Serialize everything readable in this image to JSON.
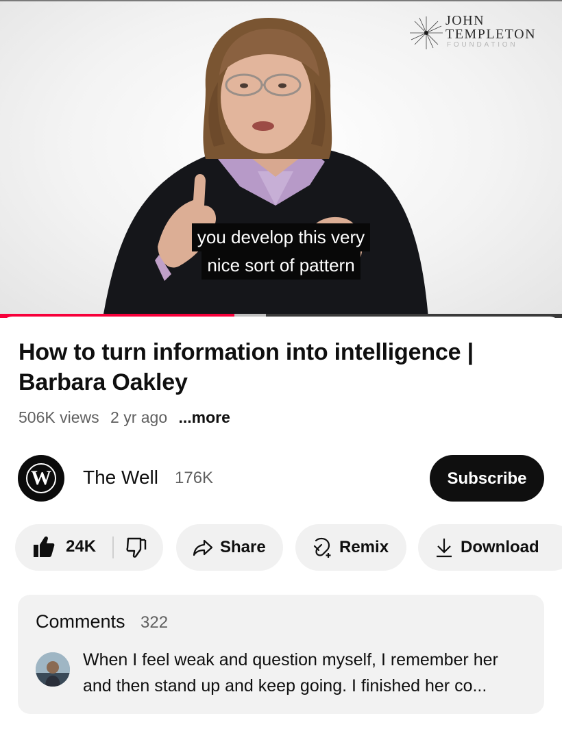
{
  "player": {
    "caption_line1": "you develop this very",
    "caption_line2": "nice sort of pattern",
    "watermark": {
      "line1": "JOHN",
      "line2": "TEMPLETON",
      "line3": "FOUNDATION"
    },
    "progress_fraction": 0.417,
    "buffered_fraction": 0.473,
    "colors": {
      "played": "#f7003a",
      "buffered": "#bdbdbd"
    }
  },
  "video": {
    "title": "How to turn information into intelligence | Barbara Oakley",
    "views": "506K views",
    "age": "2 yr ago",
    "more_label": "...more"
  },
  "channel": {
    "avatar_letter": "W",
    "name": "The Well",
    "subscribers": "176K",
    "subscribe_label": "Subscribe"
  },
  "actions": {
    "like_count": "24K",
    "like_icon": "thumb-up-icon",
    "dislike_icon": "thumb-down-icon",
    "share_label": "Share",
    "share_icon": "share-arrow-icon",
    "remix_label": "Remix",
    "remix_icon": "remix-icon",
    "download_label": "Download",
    "download_icon": "download-icon"
  },
  "comments": {
    "header": "Comments",
    "count": "322",
    "top_comment": "When I feel weak and question myself, I remember her and then stand up and keep going. I finished her co..."
  }
}
